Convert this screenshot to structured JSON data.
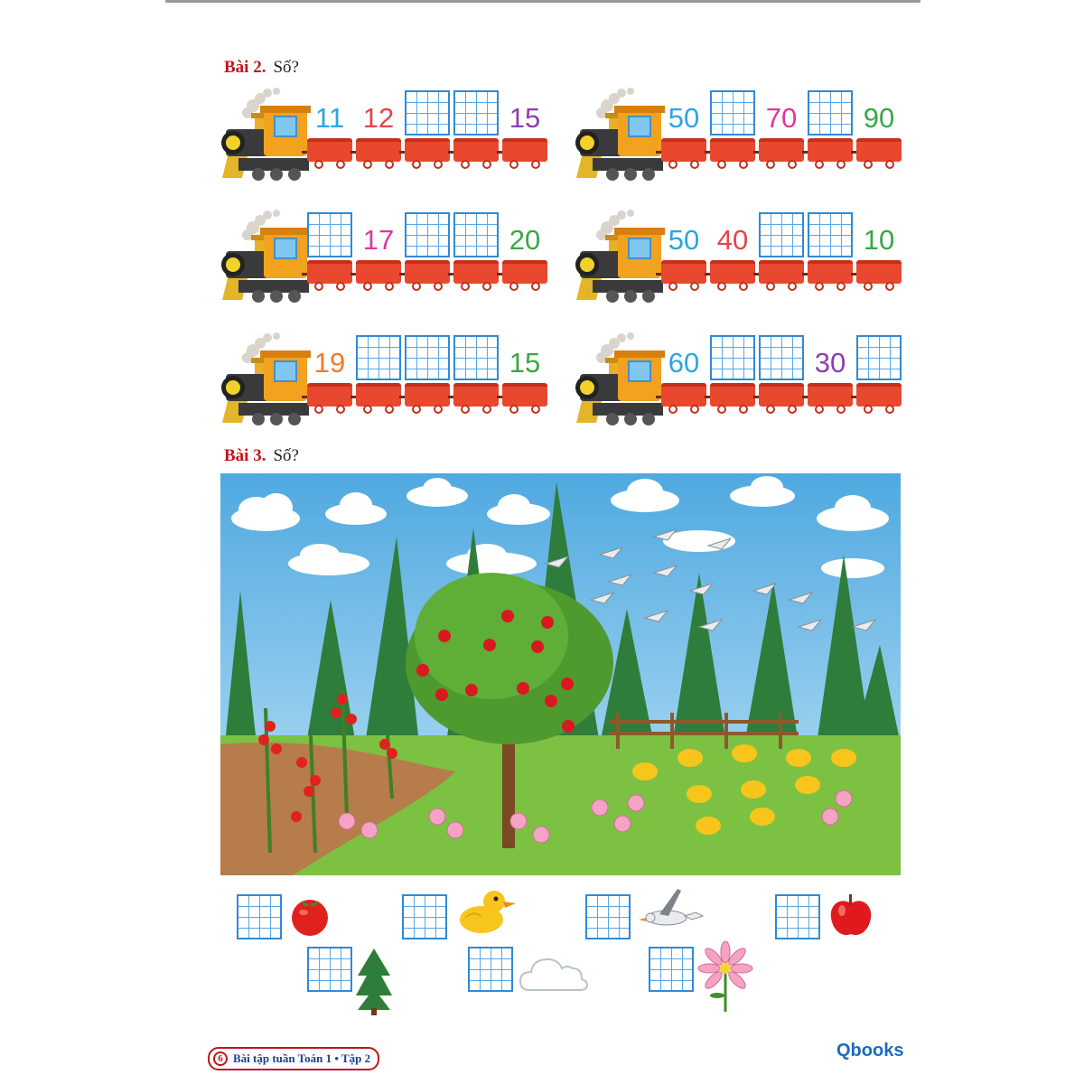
{
  "exercise2": {
    "label": "Bài 2.",
    "prompt": "Số?"
  },
  "exercise3": {
    "label": "Bài 3.",
    "prompt": "Số?"
  },
  "trains": [
    {
      "cells": [
        {
          "value": "11",
          "color": "#2aa6df"
        },
        {
          "value": "12",
          "color": "#e8434a"
        },
        {
          "value": "",
          "color": ""
        },
        {
          "value": "",
          "color": ""
        },
        {
          "value": "15",
          "color": "#8e3fb0"
        }
      ]
    },
    {
      "cells": [
        {
          "value": "50",
          "color": "#2aa6df"
        },
        {
          "value": "",
          "color": ""
        },
        {
          "value": "70",
          "color": "#e0379a"
        },
        {
          "value": "",
          "color": ""
        },
        {
          "value": "90",
          "color": "#39a648"
        }
      ]
    },
    {
      "cells": [
        {
          "value": "",
          "color": ""
        },
        {
          "value": "17",
          "color": "#e0379a"
        },
        {
          "value": "",
          "color": ""
        },
        {
          "value": "",
          "color": ""
        },
        {
          "value": "20",
          "color": "#39a648"
        }
      ]
    },
    {
      "cells": [
        {
          "value": "50",
          "color": "#2aa6df"
        },
        {
          "value": "40",
          "color": "#e8434a"
        },
        {
          "value": "",
          "color": ""
        },
        {
          "value": "",
          "color": ""
        },
        {
          "value": "10",
          "color": "#39a648"
        }
      ]
    },
    {
      "cells": [
        {
          "value": "19",
          "color": "#f07a2a"
        },
        {
          "value": "",
          "color": ""
        },
        {
          "value": "",
          "color": ""
        },
        {
          "value": "",
          "color": ""
        },
        {
          "value": "15",
          "color": "#39a648"
        }
      ]
    },
    {
      "cells": [
        {
          "value": "60",
          "color": "#2aa6df"
        },
        {
          "value": "",
          "color": ""
        },
        {
          "value": "",
          "color": ""
        },
        {
          "value": "30",
          "color": "#8e3fb0"
        },
        {
          "value": "",
          "color": ""
        }
      ]
    }
  ],
  "answers_row1": [
    "tomato-icon",
    "duck-icon",
    "goose-icon",
    "apple-icon"
  ],
  "answers_row2": [
    "pine-tree-icon",
    "cloud-icon",
    "flower-icon"
  ],
  "footer": {
    "page": "6",
    "title": "Bài tập tuần Toán 1 • Tập 2"
  },
  "logo": {
    "text": "Qbooks"
  }
}
